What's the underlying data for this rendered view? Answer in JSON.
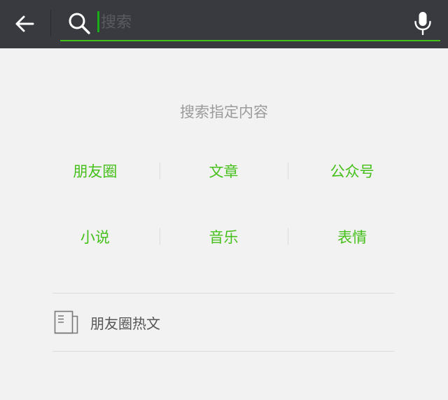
{
  "header": {
    "back_icon": "arrow-left-icon",
    "search_icon": "magnifier-icon",
    "search_placeholder": "搜索",
    "search_value": "",
    "mic_icon": "microphone-icon"
  },
  "hint": "搜索指定内容",
  "categories": [
    {
      "label": "朋友圈"
    },
    {
      "label": "文章"
    },
    {
      "label": "公众号"
    },
    {
      "label": "小说"
    },
    {
      "label": "音乐"
    },
    {
      "label": "表情"
    }
  ],
  "hot_item": {
    "icon": "article-icon",
    "label": "朋友圈热文"
  },
  "colors": {
    "topbar": "#393a3f",
    "accent_green": "#45c01a",
    "background": "#f2f2f2"
  }
}
